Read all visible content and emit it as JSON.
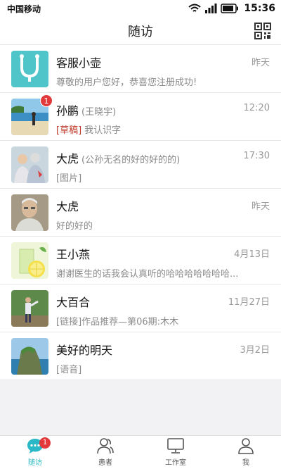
{
  "status_bar": {
    "carrier": "中国移动",
    "time": "15:36"
  },
  "nav": {
    "title": "随访",
    "qr_icon": "qr-code-icon"
  },
  "conversations": [
    {
      "name": "客服小壶",
      "remark": "",
      "time": "昨天",
      "tag": "",
      "preview": "尊敬的用户您好，恭喜您注册成功!",
      "badge": "",
      "avatar": "stethoscope-logo"
    },
    {
      "name": "孙鹏",
      "remark": "(王晓宇)",
      "time": "12:20",
      "tag": "[草稿]",
      "preview": "我认识字",
      "badge": "1",
      "avatar": "beach-photo"
    },
    {
      "name": "大虎",
      "remark": "(公孙无名的好的好的的)",
      "time": "17:30",
      "tag": "",
      "preview": "[图片]",
      "badge": "",
      "avatar": "elderly-couple-photo"
    },
    {
      "name": "大虎",
      "remark": "",
      "time": "昨天",
      "tag": "",
      "preview": "好的好的",
      "badge": "",
      "avatar": "elderly-man-photo"
    },
    {
      "name": "王小燕",
      "remark": "",
      "time": "4月13日",
      "tag": "",
      "preview": "谢谢医生的话我会认真听的哈哈哈哈哈哈哈...",
      "badge": "",
      "avatar": "lemon-drink-photo"
    },
    {
      "name": "大百合",
      "remark": "",
      "time": "11月27日",
      "tag": "",
      "preview": "[链接]作品推荐—第06期:木木",
      "badge": "",
      "avatar": "outdoor-person-photo"
    },
    {
      "name": "美好的明天",
      "remark": "",
      "time": "3月2日",
      "tag": "",
      "preview": "[语音]",
      "badge": "",
      "avatar": "coast-photo"
    }
  ],
  "tabs": [
    {
      "label": "随访",
      "icon": "chat-bubble-icon",
      "active": true,
      "badge": "1"
    },
    {
      "label": "患者",
      "icon": "patients-icon",
      "active": false,
      "badge": ""
    },
    {
      "label": "工作室",
      "icon": "monitor-icon",
      "active": false,
      "badge": ""
    },
    {
      "label": "我",
      "icon": "person-icon",
      "active": false,
      "badge": ""
    }
  ],
  "colors": {
    "accent": "#2bb8c6",
    "badge": "#e23a3a",
    "draft": "#c0392b"
  }
}
